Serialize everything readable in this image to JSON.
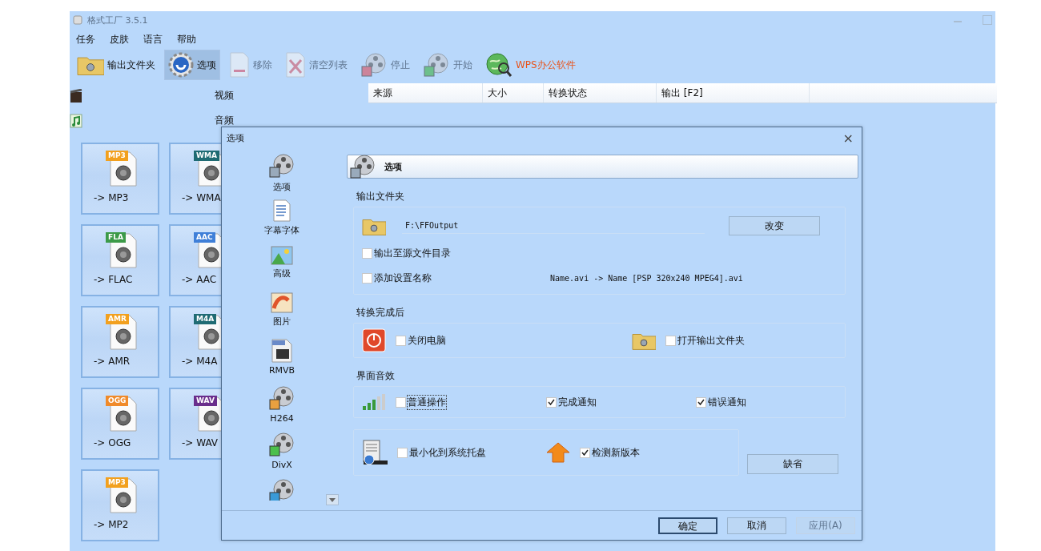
{
  "window": {
    "title": "格式工厂 3.5.1"
  },
  "menu": [
    "任务",
    "皮肤",
    "语言",
    "帮助"
  ],
  "toolbar": [
    {
      "label": "输出文件夹",
      "kind": "normal",
      "disabled": false,
      "selected": false
    },
    {
      "label": "选项",
      "kind": "normal",
      "disabled": false,
      "selected": true
    },
    {
      "label": "移除",
      "kind": "normal",
      "disabled": true,
      "selected": false
    },
    {
      "label": "清空列表",
      "kind": "normal",
      "disabled": true,
      "selected": false
    },
    {
      "label": "停止",
      "kind": "normal",
      "disabled": true,
      "selected": false
    },
    {
      "label": "开始",
      "kind": "normal",
      "disabled": true,
      "selected": false
    },
    {
      "label": "WPS办公软件",
      "kind": "promo",
      "disabled": false,
      "selected": false
    }
  ],
  "categories": [
    {
      "label": "视频"
    },
    {
      "label": "音频"
    }
  ],
  "tiles": [
    {
      "badge": "MP3",
      "color": "#f2a01e",
      "label": "-> MP3"
    },
    {
      "badge": "WMA",
      "color": "#1f6b73",
      "label": "-> WMA"
    },
    {
      "badge": "FLA",
      "color": "#3c9a48",
      "label": "-> FLAC"
    },
    {
      "badge": "AAC",
      "color": "#3f7fd8",
      "label": "-> AAC"
    },
    {
      "badge": "AMR",
      "color": "#f2a01e",
      "label": "-> AMR"
    },
    {
      "badge": "M4A",
      "color": "#1f6b73",
      "label": "-> M4A"
    },
    {
      "badge": "OGG",
      "color": "#f08a2a",
      "label": "-> OGG"
    },
    {
      "badge": "WAV",
      "color": "#6a2e8c",
      "label": "-> WAV"
    },
    {
      "badge": "MP3",
      "color": "#f2a01e",
      "label": "-> MP2"
    }
  ],
  "file_list": {
    "columns": [
      "来源",
      "大小",
      "转换状态",
      "输出 [F2]"
    ]
  },
  "dialog": {
    "title": "选项",
    "close": "×",
    "nav": [
      {
        "label": "选项"
      },
      {
        "label": "字幕字体"
      },
      {
        "label": "高级"
      },
      {
        "label": "图片"
      },
      {
        "label": "RMVB"
      },
      {
        "label": "H264"
      },
      {
        "label": "DivX"
      }
    ],
    "header": "选项",
    "output_section": {
      "title": "输出文件夹",
      "path": "F:\\FFOutput",
      "change_button": "改变",
      "options": [
        {
          "label": "输出至源文件目录",
          "checked": false
        },
        {
          "label": "添加设置名称",
          "checked": false,
          "example": "Name.avi  -> Name [PSP 320x240 MPEG4].avi"
        }
      ]
    },
    "after_section": {
      "title": "转换完成后",
      "options": [
        {
          "label": "关闭电脑",
          "checked": false
        },
        {
          "label": "打开输出文件夹",
          "checked": false
        }
      ]
    },
    "sound_section": {
      "title": "界面音效",
      "options": [
        {
          "label": "普通操作",
          "checked": false,
          "focused": true
        },
        {
          "label": "完成通知",
          "checked": true,
          "focused": false
        },
        {
          "label": "错误通知",
          "checked": true,
          "focused": false
        }
      ]
    },
    "misc_section": {
      "options": [
        {
          "label": "最小化到系统托盘",
          "checked": false
        },
        {
          "label": "检测新版本",
          "checked": true
        }
      ],
      "default_button": "缺省"
    },
    "buttons": [
      {
        "label": "确定",
        "disabled": false,
        "default": true
      },
      {
        "label": "取消",
        "disabled": false,
        "default": false
      },
      {
        "label": "应用(A)",
        "disabled": true,
        "default": false
      }
    ]
  }
}
